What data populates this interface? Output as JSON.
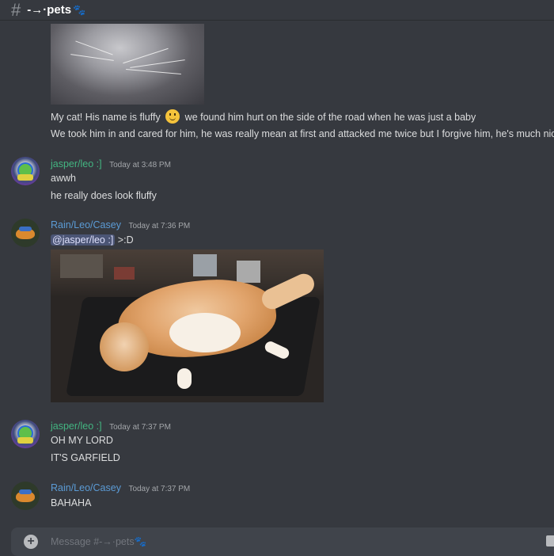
{
  "header": {
    "hash": "#",
    "channel": "-→·pets",
    "channel_deco": "🐾"
  },
  "messages": [
    {
      "lines": [
        "My cat! His name is fluffy",
        "we found him hurt on the side of the road when he was just a baby",
        "We took him in and cared for him, he was really mean at first and attacked me twice but I forgive him, he's much nice"
      ]
    },
    {
      "author": "jasper/leo :]",
      "timestamp": "Today at 3:48 PM",
      "lines": [
        "awwh",
        "he really does look fluffy"
      ]
    },
    {
      "author": "Rain/Leo/Casey",
      "timestamp": "Today at 7:36 PM",
      "mention": "@jasper/leo :]",
      "text_after_mention": ">:D"
    },
    {
      "author": "jasper/leo :]",
      "timestamp": "Today at 7:37 PM",
      "lines": [
        "OH MY LORD",
        "IT'S GARFIELD"
      ]
    },
    {
      "author": "Rain/Leo/Casey",
      "timestamp": "Today at 7:37 PM",
      "lines": [
        "BAHAHA"
      ]
    }
  ],
  "composer": {
    "placeholder": "Message #-→·pets🐾",
    "plus_icon": "+"
  },
  "colors": {
    "background": "#36393f",
    "composer_bg": "#40444b",
    "username_green": "#43b581",
    "username_blue": "#5b9bd5",
    "mention_bg": "rgba(114,137,218,0.35)"
  }
}
